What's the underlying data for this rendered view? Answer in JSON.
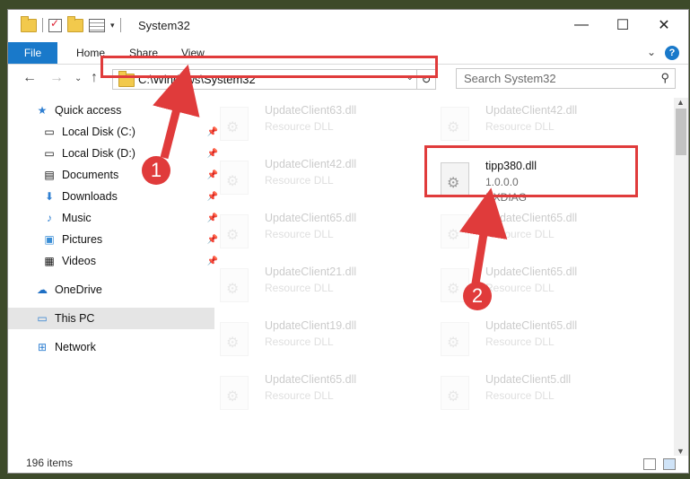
{
  "window": {
    "title": "System32",
    "minimize_glyph": "—",
    "maximize_glyph": "☐",
    "close_glyph": "✕"
  },
  "ribbon": {
    "tabs": [
      "File",
      "Home",
      "Share",
      "View"
    ],
    "help_glyph": "?",
    "expand_glyph": "⌄"
  },
  "address": {
    "path": "C:\\Windows\\System32",
    "search_placeholder": "Search System32"
  },
  "nav_pane": [
    {
      "label": "Quick access",
      "icon": "star-icon",
      "pinned": false
    },
    {
      "label": "Local Disk (C:)",
      "icon": "drive-icon",
      "pinned": true
    },
    {
      "label": "Local Disk (D:)",
      "icon": "drive-icon",
      "pinned": true
    },
    {
      "label": "Documents",
      "icon": "documents-icon",
      "pinned": true
    },
    {
      "label": "Downloads",
      "icon": "downloads-icon",
      "pinned": true
    },
    {
      "label": "Music",
      "icon": "music-icon",
      "pinned": true
    },
    {
      "label": "Pictures",
      "icon": "pictures-icon",
      "pinned": true
    },
    {
      "label": "Videos",
      "icon": "videos-icon",
      "pinned": true
    },
    {
      "label": "OneDrive",
      "icon": "cloud-icon",
      "pinned": false
    },
    {
      "label": "This PC",
      "icon": "computer-icon",
      "pinned": false,
      "selected": true
    },
    {
      "label": "Network",
      "icon": "network-icon",
      "pinned": false
    }
  ],
  "files": {
    "left_column": [
      {
        "name": "UpdateClient63.dll",
        "type": "Resource DLL"
      },
      {
        "name": "UpdateClient42.dll",
        "type": "Resource DLL"
      },
      {
        "name": "UpdateClient65.dll",
        "type": "Resource DLL"
      },
      {
        "name": "UpdateClient21.dll",
        "type": "Resource DLL"
      },
      {
        "name": "UpdateClient19.dll",
        "type": "Resource DLL"
      },
      {
        "name": "UpdateClient65.dll",
        "type": "Resource DLL"
      }
    ],
    "right_column": [
      {
        "name": "UpdateClient42.dll",
        "type": "Resource DLL"
      },
      {
        "name": "UpdateClient65.dll",
        "type": "Resource DLL"
      },
      {
        "name": "UpdateClient65.dll",
        "type": "Resource DLL"
      },
      {
        "name": "UpdateClient65.dll",
        "type": "Resource DLL"
      },
      {
        "name": "UpdateClient5.dll",
        "type": "Resource DLL"
      }
    ],
    "highlighted": {
      "name": "tipp380.dll",
      "version": "1.0.0.0",
      "description": "DXDIAG"
    }
  },
  "status": {
    "item_count": "196 items"
  },
  "callouts": [
    "1",
    "2"
  ],
  "colors": {
    "accent": "#1979ca",
    "annotation": "#e03b3b"
  }
}
